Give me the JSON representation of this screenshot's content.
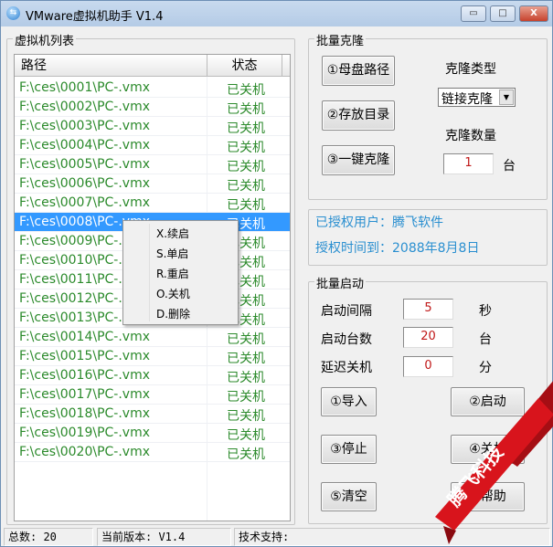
{
  "window": {
    "title": "VMware虚拟机助手 V1.4",
    "minimize": "▭",
    "maximize": "□",
    "close": "X"
  },
  "vm_list": {
    "title": "虚拟机列表",
    "columns": [
      "路径",
      "状态"
    ],
    "rows": [
      {
        "path": "F:\\ces\\0001\\PC-.vmx",
        "status": "已关机"
      },
      {
        "path": "F:\\ces\\0002\\PC-.vmx",
        "status": "已关机"
      },
      {
        "path": "F:\\ces\\0003\\PC-.vmx",
        "status": "已关机"
      },
      {
        "path": "F:\\ces\\0004\\PC-.vmx",
        "status": "已关机"
      },
      {
        "path": "F:\\ces\\0005\\PC-.vmx",
        "status": "已关机"
      },
      {
        "path": "F:\\ces\\0006\\PC-.vmx",
        "status": "已关机"
      },
      {
        "path": "F:\\ces\\0007\\PC-.vmx",
        "status": "已关机"
      },
      {
        "path": "F:\\ces\\0008\\PC-.vmx",
        "status": "已关机"
      },
      {
        "path": "F:\\ces\\0009\\PC-.vmx",
        "status": "已关机"
      },
      {
        "path": "F:\\ces\\0010\\PC-.vmx",
        "status": "已关机"
      },
      {
        "path": "F:\\ces\\0011\\PC-.vmx",
        "status": "已关机"
      },
      {
        "path": "F:\\ces\\0012\\PC-.vmx",
        "status": "已关机"
      },
      {
        "path": "F:\\ces\\0013\\PC-.vmx",
        "status": "已关机"
      },
      {
        "path": "F:\\ces\\0014\\PC-.vmx",
        "status": "已关机"
      },
      {
        "path": "F:\\ces\\0015\\PC-.vmx",
        "status": "已关机"
      },
      {
        "path": "F:\\ces\\0016\\PC-.vmx",
        "status": "已关机"
      },
      {
        "path": "F:\\ces\\0017\\PC-.vmx",
        "status": "已关机"
      },
      {
        "path": "F:\\ces\\0018\\PC-.vmx",
        "status": "已关机"
      },
      {
        "path": "F:\\ces\\0019\\PC-.vmx",
        "status": "已关机"
      },
      {
        "path": "F:\\ces\\0020\\PC-.vmx",
        "status": "已关机"
      }
    ],
    "selected_index": 7
  },
  "context_menu": [
    "X.续启",
    "S.单启",
    "R.重启",
    "O.关机",
    "D.删除"
  ],
  "clone": {
    "title": "批量克隆",
    "btn_source": "①母盘路径",
    "btn_dest": "②存放目录",
    "btn_clone": "③一键克隆",
    "type_label": "克隆类型",
    "type_value": "链接克隆",
    "count_label": "克隆数量",
    "count_value": "1",
    "count_unit": "台"
  },
  "license": {
    "user": "已授权用户：腾飞软件",
    "expire": "授权时间到：2088年8月8日",
    "color": "#2a8fd0"
  },
  "batch": {
    "title": "批量启动",
    "interval_label": "启动间隔",
    "interval_value": "5",
    "interval_unit": "秒",
    "count_label": "启动台数",
    "count_value": "20",
    "count_unit": "台",
    "delay_label": "延迟关机",
    "delay_value": "0",
    "delay_unit": "分",
    "btn_import": "①导入",
    "btn_start": "②启动",
    "btn_stop": "③停止",
    "btn_4": "④关机",
    "btn_clear": "⑤清空",
    "btn_help": "⑥帮助"
  },
  "status": {
    "total": "总数: 20",
    "version": "当前版本: V1.4",
    "support": "技术支持:"
  },
  "ribbon": {
    "text": "腾飞科技",
    "color": "#d8141c"
  }
}
